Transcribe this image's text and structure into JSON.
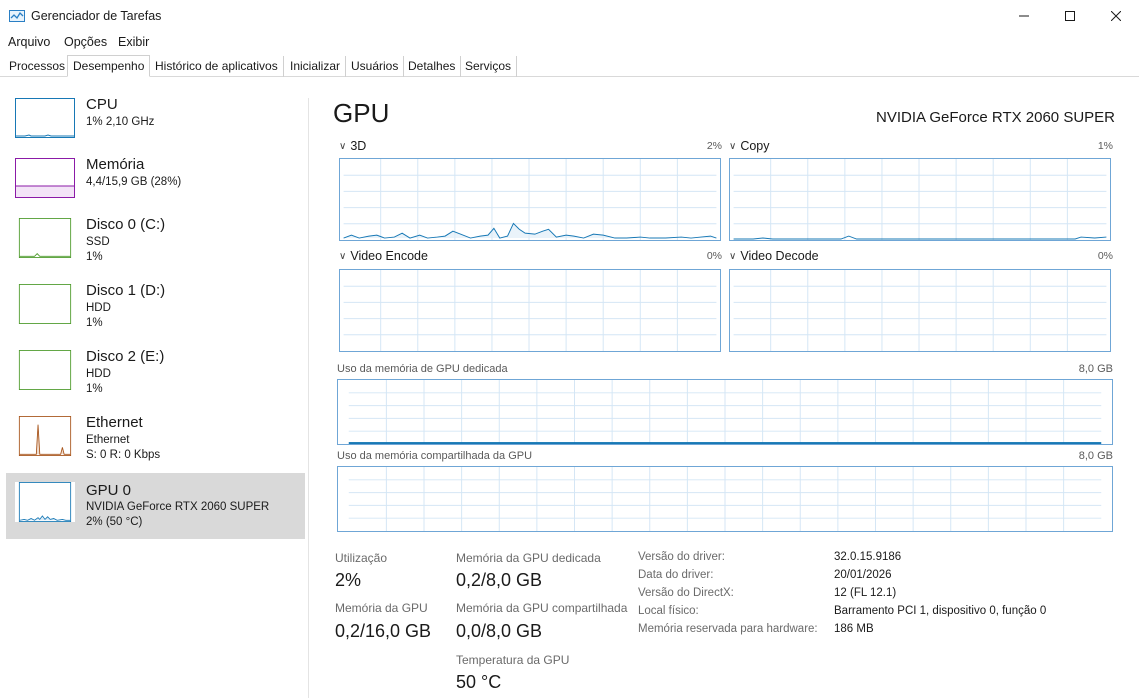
{
  "window": {
    "title": "Gerenciador de Tarefas",
    "icon": "task-manager-icon",
    "controls": [
      "minimize-icon",
      "maximize-icon",
      "close-icon"
    ]
  },
  "menu": [
    "Arquivo",
    "Opções",
    "Exibir"
  ],
  "tabs": [
    {
      "label": "Processos",
      "active": false
    },
    {
      "label": "Desempenho",
      "active": true
    },
    {
      "label": "Histórico de aplicativos",
      "active": false
    },
    {
      "label": "Inicializar",
      "active": false
    },
    {
      "label": "Usuários",
      "active": false
    },
    {
      "label": "Detalhes",
      "active": false
    },
    {
      "label": "Serviços",
      "active": false
    }
  ],
  "sidebar": {
    "items": [
      {
        "title": "CPU",
        "lines": [
          "1% 2,10 GHz"
        ],
        "color": "#1778b5",
        "selected": false
      },
      {
        "title": "Memória",
        "lines": [
          "4,4/15,9 GB (28%)"
        ],
        "color": "#8b1aa7",
        "selected": false
      },
      {
        "title": "Disco 0 (C:)",
        "lines": [
          "SSD",
          "1%"
        ],
        "color": "#4c9a2a",
        "selected": false
      },
      {
        "title": "Disco 1 (D:)",
        "lines": [
          "HDD",
          "1%"
        ],
        "color": "#4c9a2a",
        "selected": false
      },
      {
        "title": "Disco 2 (E:)",
        "lines": [
          "HDD",
          "1%"
        ],
        "color": "#4c9a2a",
        "selected": false
      },
      {
        "title": "Ethernet",
        "lines": [
          "Ethernet",
          "S: 0 R: 0 Kbps"
        ],
        "color": "#a7541a",
        "selected": false
      },
      {
        "title": "GPU 0",
        "lines": [
          "NVIDIA GeForce RTX 2060 SUPER",
          "2% (50 °C)"
        ],
        "color": "#1778b5",
        "selected": true
      }
    ]
  },
  "main": {
    "heading": "GPU",
    "model": "NVIDIA GeForce RTX 2060 SUPER",
    "engines": [
      {
        "label": "3D",
        "percent": "2%"
      },
      {
        "label": "Copy",
        "percent": "1%"
      },
      {
        "label": "Video Encode",
        "percent": "0%"
      },
      {
        "label": "Video Decode",
        "percent": "0%"
      }
    ],
    "memory_graphs": [
      {
        "label": "Uso da memória de GPU dedicada",
        "max": "8,0 GB"
      },
      {
        "label": "Uso da memória compartilhada da GPU",
        "max": "8,0 GB"
      }
    ],
    "stats": {
      "utilization_label": "Utilização",
      "utilization_value": "2%",
      "gpu_memory_label": "Memória da GPU",
      "gpu_memory_value": "0,2/16,0 GB",
      "dedicated_label": "Memória da GPU dedicada",
      "dedicated_value": "0,2/8,0 GB",
      "shared_label": "Memória da GPU compartilhada",
      "shared_value": "0,0/8,0 GB",
      "temp_label": "Temperatura da GPU",
      "temp_value": "50 °C"
    },
    "info": [
      {
        "key": "Versão do driver:",
        "value": "32.0.15.9186"
      },
      {
        "key": "Data do driver:",
        "value": "20/01/2026"
      },
      {
        "key": "Versão do DirectX:",
        "value": "12 (FL 12.1)"
      },
      {
        "key": "Local físico:",
        "value": "Barramento PCI 1, dispositivo 0, função 0"
      },
      {
        "key": "Memória reservada para hardware:",
        "value": "186 MB"
      }
    ],
    "accent_color": "#1778b5",
    "grid_color": "#d4e6f5"
  }
}
